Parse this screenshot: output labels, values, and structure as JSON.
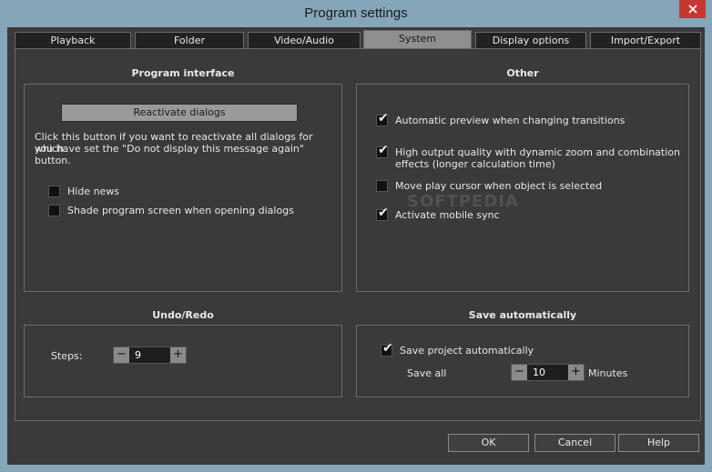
{
  "window": {
    "title": "Program settings"
  },
  "tabs": [
    "Playback",
    "Folder",
    "Video/Audio",
    "System",
    "Display options",
    "Import/Export"
  ],
  "program_interface": {
    "title": "Program interface",
    "reactivate_label": "Reactivate dialogs",
    "description_line1": "Click this button if you want to reactivate all dialogs for which",
    "description_line2": "you have set the \"Do not display this message again\" button.",
    "hide_news": "Hide news",
    "shade_screen": "Shade program screen when opening dialogs"
  },
  "other": {
    "title": "Other",
    "auto_preview": "Automatic preview when changing transitions",
    "high_quality_line1": "High output quality with dynamic zoom and combination",
    "high_quality_line2": "effects (longer calculation time)",
    "move_cursor": "Move play cursor when object is selected",
    "mobile_sync": "Activate mobile sync"
  },
  "undo_redo": {
    "title": "Undo/Redo",
    "steps_label": "Steps:",
    "steps_value": "9"
  },
  "save_auto": {
    "title": "Save automatically",
    "save_project": "Save project automatically",
    "save_all_label": "Save all",
    "minutes_value": "10",
    "minutes_label": "Minutes"
  },
  "footer": {
    "ok": "OK",
    "cancel": "Cancel",
    "help": "Help"
  },
  "watermark": "SOFTPEDIA"
}
